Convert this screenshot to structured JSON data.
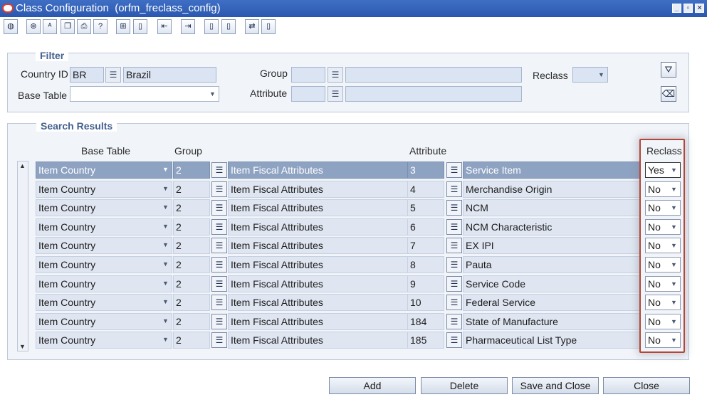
{
  "window": {
    "title": "Class Configuration  (orfm_freclass_config)",
    "controls": [
      "minimize",
      "restore",
      "close"
    ]
  },
  "toolbar": {
    "icons": [
      "globe-icon",
      "action-icon",
      "spell-icon",
      "copy-icon",
      "print-icon",
      "help-icon",
      "tree-icon",
      "new-doc-icon",
      "tree-left-icon",
      "tree-right-icon",
      "doc-a-icon",
      "doc-b-icon",
      "tree-move-icon",
      "doc-c-icon"
    ]
  },
  "filter": {
    "legend": "Filter",
    "country_id_label": "Country ID",
    "country_id_code": "BR",
    "country_id_name": "Brazil",
    "base_table_label": "Base Table",
    "base_table_value": "",
    "group_label": "Group",
    "group_code": "",
    "group_name": "",
    "attribute_label": "Attribute",
    "attribute_code": "",
    "attribute_name": "",
    "reclass_label": "Reclass",
    "reclass_value": ""
  },
  "results": {
    "legend": "Search Results",
    "headers": {
      "base_table": "Base Table",
      "group": "Group",
      "attribute": "Attribute",
      "reclass": "Reclass"
    },
    "rows": [
      {
        "base_table": "Item Country",
        "group_id": "2",
        "group_name": "Item Fiscal Attributes",
        "attr_id": "3",
        "attr_name": "Service Item",
        "reclass": "Yes",
        "selected": true
      },
      {
        "base_table": "Item Country",
        "group_id": "2",
        "group_name": "Item Fiscal Attributes",
        "attr_id": "4",
        "attr_name": "Merchandise Origin",
        "reclass": "No"
      },
      {
        "base_table": "Item Country",
        "group_id": "2",
        "group_name": "Item Fiscal Attributes",
        "attr_id": "5",
        "attr_name": "NCM",
        "reclass": "No"
      },
      {
        "base_table": "Item Country",
        "group_id": "2",
        "group_name": "Item Fiscal Attributes",
        "attr_id": "6",
        "attr_name": "NCM Characteristic",
        "reclass": "No"
      },
      {
        "base_table": "Item Country",
        "group_id": "2",
        "group_name": "Item Fiscal Attributes",
        "attr_id": "7",
        "attr_name": "EX IPI",
        "reclass": "No"
      },
      {
        "base_table": "Item Country",
        "group_id": "2",
        "group_name": "Item Fiscal Attributes",
        "attr_id": "8",
        "attr_name": "Pauta",
        "reclass": "No"
      },
      {
        "base_table": "Item Country",
        "group_id": "2",
        "group_name": "Item Fiscal Attributes",
        "attr_id": "9",
        "attr_name": "Service Code",
        "reclass": "No"
      },
      {
        "base_table": "Item Country",
        "group_id": "2",
        "group_name": "Item Fiscal Attributes",
        "attr_id": "10",
        "attr_name": "Federal Service",
        "reclass": "No"
      },
      {
        "base_table": "Item Country",
        "group_id": "2",
        "group_name": "Item Fiscal Attributes",
        "attr_id": "184",
        "attr_name": "State of Manufacture",
        "reclass": "No"
      },
      {
        "base_table": "Item Country",
        "group_id": "2",
        "group_name": "Item Fiscal Attributes",
        "attr_id": "185",
        "attr_name": "Pharmaceutical List Type",
        "reclass": "No"
      }
    ]
  },
  "buttons": {
    "add": "Add",
    "delete": "Delete",
    "save_close": "Save and Close",
    "close": "Close"
  },
  "colors": {
    "titlebar": "#2a58b0",
    "selected_row": "#8ea2c2",
    "highlight_border": "#b54636"
  }
}
